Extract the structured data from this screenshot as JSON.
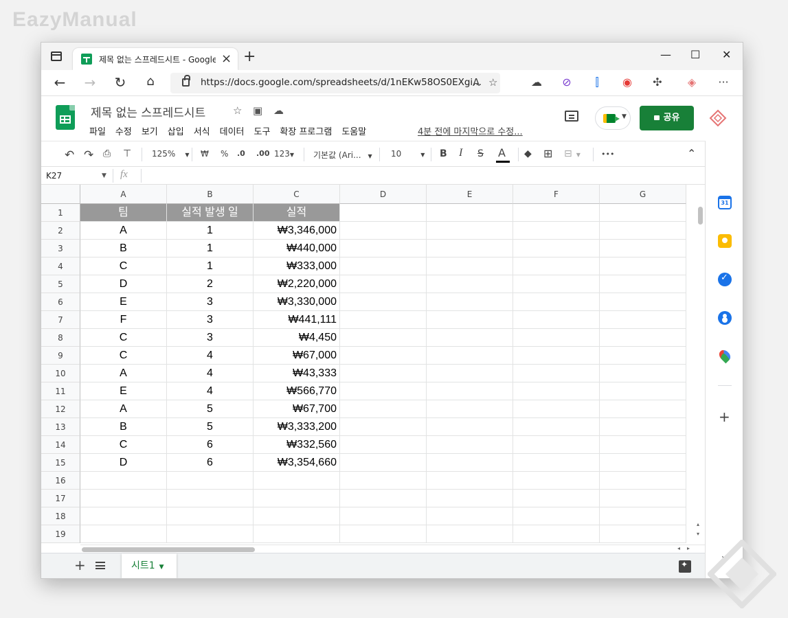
{
  "watermark": "EazyManual",
  "browser": {
    "tab_title": "제목 없는 스프레드시트 - Google Sheets",
    "url": "https://docs.google.com/spreadsheets/d/1nEKw58OS0EXgi...",
    "new_tab": "+",
    "close": "×",
    "min": "—",
    "max": "☐",
    "win_close": "✕"
  },
  "app": {
    "title": "제목 없는 스프레드시트",
    "menus": [
      "파일",
      "수정",
      "보기",
      "삽입",
      "서식",
      "데이터",
      "도구",
      "확장 프로그램",
      "도움말"
    ],
    "last_edit": "4분 전에 마지막으로 수정...",
    "share_label": "공유"
  },
  "toolbar": {
    "zoom": "125%",
    "currency": "₩",
    "percent": "%",
    "dec_decrease": ".0",
    "dec_increase": ".00",
    "format_more": "123",
    "font": "기본값 (Ari...",
    "font_size": "10",
    "bold": "B",
    "italic": "I",
    "strike": "S",
    "text_color": "A",
    "more": "•••"
  },
  "formula_bar": {
    "name_box": "K27",
    "fx": "fx"
  },
  "columns": [
    "A",
    "B",
    "C",
    "D",
    "E",
    "F",
    "G"
  ],
  "rows": [
    "1",
    "2",
    "3",
    "4",
    "5",
    "6",
    "7",
    "8",
    "9",
    "10",
    "11",
    "12",
    "13",
    "14",
    "15",
    "16",
    "17",
    "18",
    "19"
  ],
  "table": {
    "headers": [
      "팀",
      "실적 발생 일",
      "실적"
    ],
    "data": [
      [
        "A",
        "1",
        "₩3,346,000"
      ],
      [
        "B",
        "1",
        "₩440,000"
      ],
      [
        "C",
        "1",
        "₩333,000"
      ],
      [
        "D",
        "2",
        "₩2,220,000"
      ],
      [
        "E",
        "3",
        "₩3,330,000"
      ],
      [
        "F",
        "3",
        "₩441,111"
      ],
      [
        "C",
        "3",
        "₩4,450"
      ],
      [
        "C",
        "4",
        "₩67,000"
      ],
      [
        "A",
        "4",
        "₩43,333"
      ],
      [
        "E",
        "4",
        "₩566,770"
      ],
      [
        "A",
        "5",
        "₩67,700"
      ],
      [
        "B",
        "5",
        "₩3,333,200"
      ],
      [
        "C",
        "6",
        "₩332,560"
      ],
      [
        "D",
        "6",
        "₩3,354,660"
      ]
    ]
  },
  "sheet_tab": "시트1",
  "side_calendar_day": "31",
  "colors": {
    "sheets_green": "#0f9d58",
    "share_green": "#188038",
    "header_fill": "#999999"
  }
}
